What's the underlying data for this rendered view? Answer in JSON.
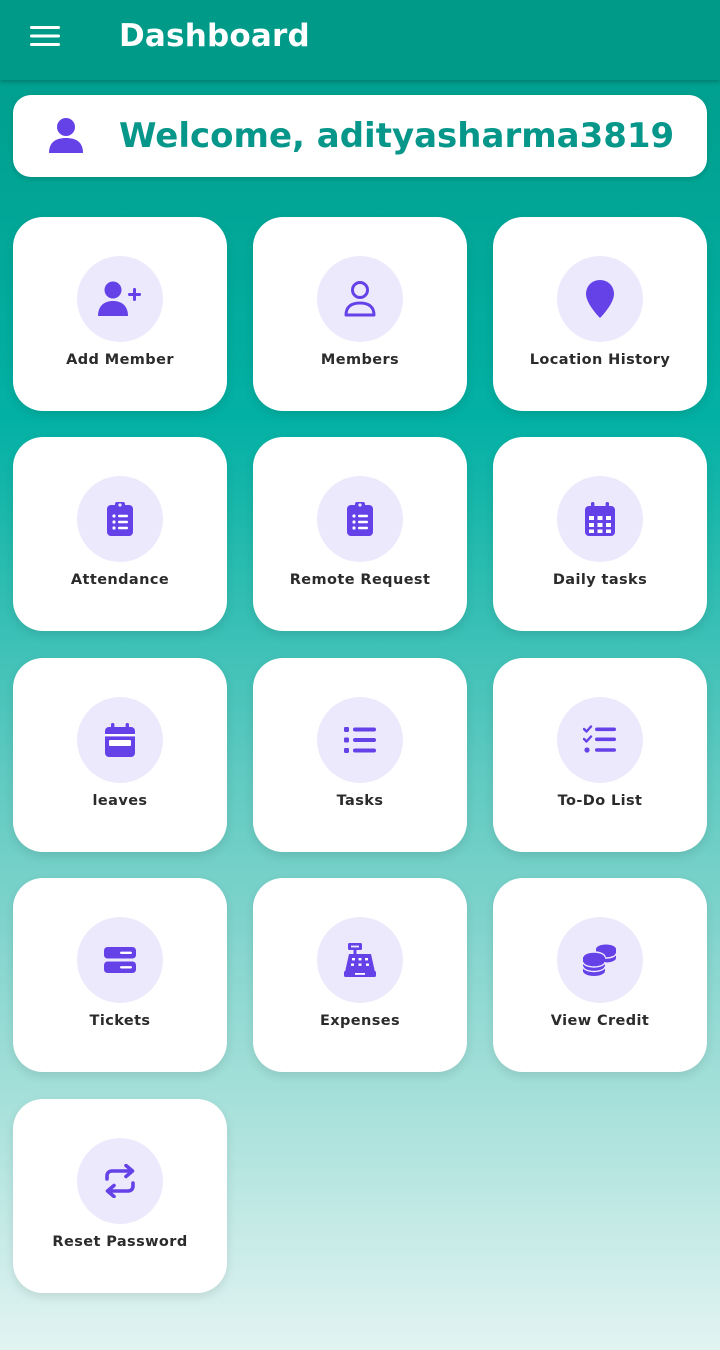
{
  "appbar": {
    "title": "Dashboard",
    "menu_icon": "hamburger-menu-icon"
  },
  "welcome": {
    "text": "Welcome, adityasharma3819",
    "icon": "user-icon"
  },
  "colors": {
    "appbar": "#009a88",
    "accent_icon": "#6442e8",
    "icon_circle_bg": "#ede9fc",
    "welcome_text": "#07978a"
  },
  "tiles": [
    {
      "label": "Add Member",
      "icon": "add-user-icon"
    },
    {
      "label": "Members",
      "icon": "user-outline-icon"
    },
    {
      "label": "Location History",
      "icon": "location-pin-icon"
    },
    {
      "label": "Attendance",
      "icon": "clipboard-list-icon"
    },
    {
      "label": "Remote Request",
      "icon": "clipboard-list-icon"
    },
    {
      "label": "Daily tasks",
      "icon": "calendar-grid-icon"
    },
    {
      "label": "leaves",
      "icon": "calendar-icon"
    },
    {
      "label": "Tasks",
      "icon": "list-icon"
    },
    {
      "label": "To-Do List",
      "icon": "checklist-icon"
    },
    {
      "label": "Tickets",
      "icon": "server-icon"
    },
    {
      "label": "Expenses",
      "icon": "cash-register-icon"
    },
    {
      "label": "View Credit",
      "icon": "coins-icon"
    },
    {
      "label": "Reset Password",
      "icon": "repeat-arrows-icon"
    }
  ]
}
